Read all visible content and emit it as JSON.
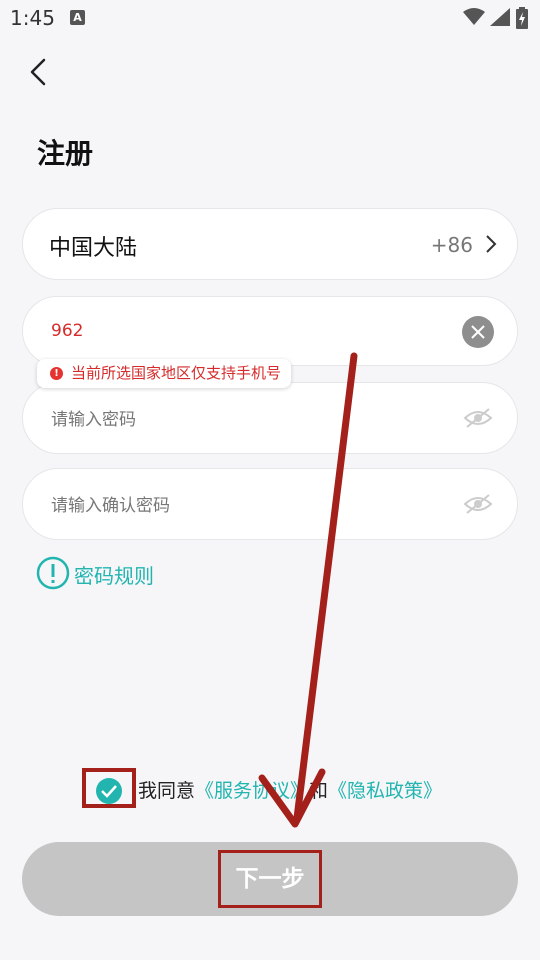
{
  "status_bar": {
    "time": "1:45",
    "notif_letter": "A"
  },
  "title": "注册",
  "region": {
    "name": "中国大陆",
    "code": "+86"
  },
  "phone": {
    "value": "962"
  },
  "error_tip": "当前所选国家地区仅支持手机号",
  "password": {
    "placeholder": "请输入密码"
  },
  "confirm_password": {
    "placeholder": "请输入确认密码"
  },
  "password_rules": "密码规则",
  "agreement": {
    "prefix": "我同意",
    "service_link": "《服务协议》",
    "conjunction": "和",
    "privacy_link": "《隐私政策》",
    "checked": true
  },
  "next_button": "下一步",
  "colors": {
    "accent": "#22b5b0",
    "error": "#d62b2b",
    "annotation": "#a4201a"
  }
}
